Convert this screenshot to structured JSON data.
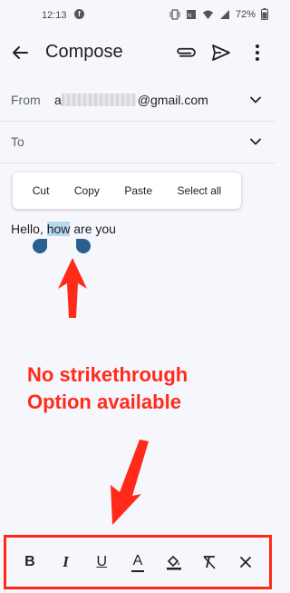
{
  "status": {
    "time": "12:13",
    "app_icon": "facebook-icon",
    "battery_percent": "72%"
  },
  "header": {
    "title": "Compose"
  },
  "compose": {
    "from_label": "From",
    "from_prefix": "a",
    "from_domain": "@gmail.com",
    "to_label": "To"
  },
  "context_menu": {
    "items": [
      "Cut",
      "Copy",
      "Paste",
      "Select all"
    ]
  },
  "body": {
    "before": "Hello, ",
    "selected": "how",
    "after": " are you"
  },
  "annotation": {
    "line1": "No strikethrough",
    "line2": "Option available"
  },
  "format_bar": {
    "bold": "B",
    "italic": "I",
    "underline": "U",
    "text_color": "A"
  },
  "colors": {
    "accent_red": "#ff2a1a",
    "selection": "#b7d8f0",
    "handle": "#2a5f8f"
  }
}
